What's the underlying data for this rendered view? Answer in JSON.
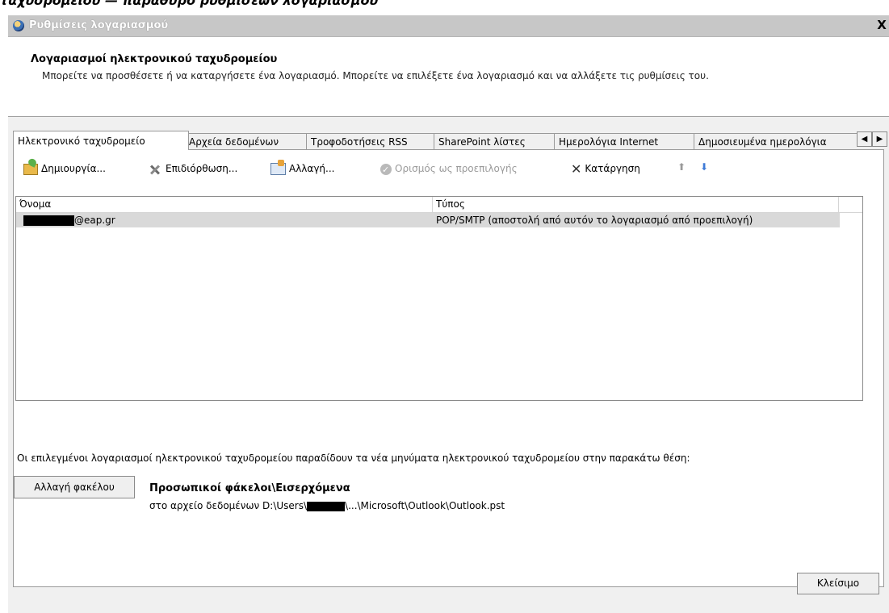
{
  "top_fragment": "ταχυδρομείου — παράθυρο ρυθμίσεων λογαριασμού",
  "window": {
    "title": "Ρυθμίσεις λογαριασμού",
    "close_glyph": "X"
  },
  "header": {
    "title": "Λογαριασμοί ηλεκτρονικού ταχυδρομείου",
    "description": "Μπορείτε να προσθέσετε ή να καταργήσετε ένα λογαριασμό. Μπορείτε να επιλέξετε ένα λογαριασμό και να αλλάξετε τις ρυθμίσεις του."
  },
  "tabs": [
    {
      "label": "Ηλεκτρονικό ταχυδρομείο",
      "active": true
    },
    {
      "label": "Αρχεία δεδομένων"
    },
    {
      "label": "Τροφοδοτήσεις RSS"
    },
    {
      "label": "SharePoint λίστες"
    },
    {
      "label": "Ημερολόγια Internet"
    },
    {
      "label": "Δημοσιευμένα ημερολόγια"
    }
  ],
  "tab_arrows": {
    "left": "◀",
    "right": "▶"
  },
  "toolbar": {
    "new_label": "Δημιουργία...",
    "repair_label": "Επιδιόρθωση...",
    "change_label": "Αλλαγή...",
    "default_label": "Ορισμός ως προεπιλογής",
    "remove_label": "Κατάργηση",
    "up_glyph": "⬆",
    "down_glyph": "⬇"
  },
  "list": {
    "columns": {
      "name": "Όνομα",
      "type": "Τύπος"
    },
    "rows": [
      {
        "name_suffix": "@eap.gr",
        "type": "POP/SMTP (αποστολή από αυτόν το λογαριασμό από προεπιλογή)"
      }
    ]
  },
  "delivery": {
    "text": "Οι επιλεγμένοι λογαριασμοί ηλεκτρονικού ταχυδρομείου παραδίδουν τα νέα μηνύματα ηλεκτρονικού ταχυδρομείου στην παρακάτω θέση:",
    "button_label": "Αλλαγή φακέλου",
    "folder_name": "Προσωπικοί φάκελοι\\Εισερχόμενα",
    "path_prefix": "στο αρχείο δεδομένων D:\\Users\\",
    "path_suffix": "\\...\\Microsoft\\Outlook\\Outlook.pst"
  },
  "footer": {
    "close_label": "Κλείσιμο"
  },
  "colors": {
    "title_bar": "#c7c7c7",
    "selected_row": "#d9d9d9",
    "down_arrow": "#3f7bd7"
  }
}
